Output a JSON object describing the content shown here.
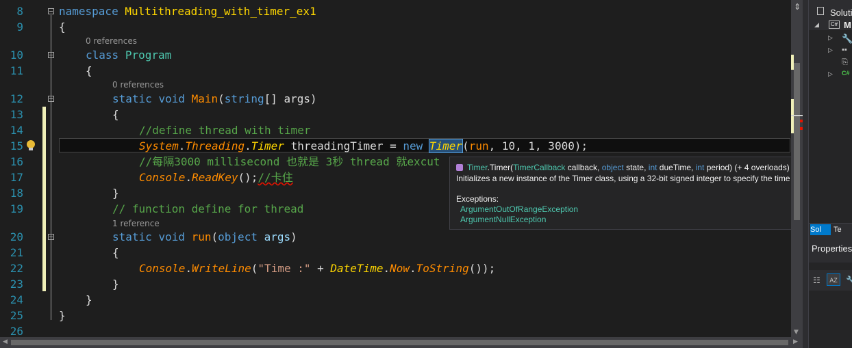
{
  "editor": {
    "line_numbers": [
      "8",
      "9",
      "10",
      "11",
      "12",
      "13",
      "14",
      "15",
      "16",
      "17",
      "18",
      "19",
      "20",
      "21",
      "22",
      "23",
      "24",
      "25",
      "26"
    ],
    "references": {
      "class_program": "0 references",
      "main": "0 references",
      "run": "1 reference"
    },
    "lines": {
      "l8_ns": "namespace",
      "l8_name": "Multithreading_with_timer_ex1",
      "brace_open": "{",
      "brace_close": "}",
      "l10_class": "class",
      "l10_name": "Program",
      "l12_static": "static",
      "l12_void": "void",
      "l12_main": "Main",
      "l12_paren": "(",
      "l12_string": "string",
      "l12_rest": "[] args)",
      "l14_comment": "//define thread with timer",
      "l15_system": "System",
      "l15_threading": "Threading",
      "l15_timer": "Timer",
      "l15_var": " threadingTimer = ",
      "l15_new": "new",
      "l15_timer2": "Timer",
      "l15_paren": "(",
      "l15_run": "run",
      "l15_args": ", 10, 1, 3000);",
      "l16_comment": "//每隔3000 millisecond 也就是 3秒 thread 就excut",
      "l17_console": "Console",
      "l17_readkey": "ReadKey",
      "l17_rest": "();",
      "l17_comment": "//卡住",
      "l19_comment": "// function define for thread",
      "l20_static": "static",
      "l20_void": "void",
      "l20_run": "run",
      "l20_object": "object",
      "l20_args": "args",
      "l22_console": "Console",
      "l22_writeline": "WriteLine",
      "l22_str": "\"Time :\"",
      "l22_plus": " + ",
      "l22_datetime": "DateTime",
      "l22_now": "Now",
      "l22_tostring": "ToString",
      "l22_end": "());",
      "dot": ".",
      "open_paren": "(",
      "close_paren": ")"
    }
  },
  "tooltip": {
    "sig_class": "Timer",
    "sig_method": ".Timer(",
    "p1_type": "TimerCallback",
    "p1_name": " callback, ",
    "p2_type": "object",
    "p2_name": " state, ",
    "p3_type": "int",
    "p3_name": " dueTime, ",
    "p4_type": "int",
    "p4_name": " period) (+ 4 overloads)",
    "description": "Initializes a new instance of the Timer class, using a 32-bit signed integer to specify the time interval.",
    "exceptions_label": "Exceptions:",
    "exceptions": [
      "ArgumentOutOfRangeException",
      "ArgumentNullException"
    ]
  },
  "right_panel": {
    "solution_label": "Soluti",
    "project_label": "M",
    "tab1": "Sol",
    "tab2": "Te",
    "properties_label": "Properties"
  },
  "colors": {
    "keyword": "#569cd6",
    "type": "#4ec9b0",
    "comment": "#57a64a",
    "string": "#d69d85",
    "method": "#dcdcaa",
    "line_number": "#2b91af"
  }
}
